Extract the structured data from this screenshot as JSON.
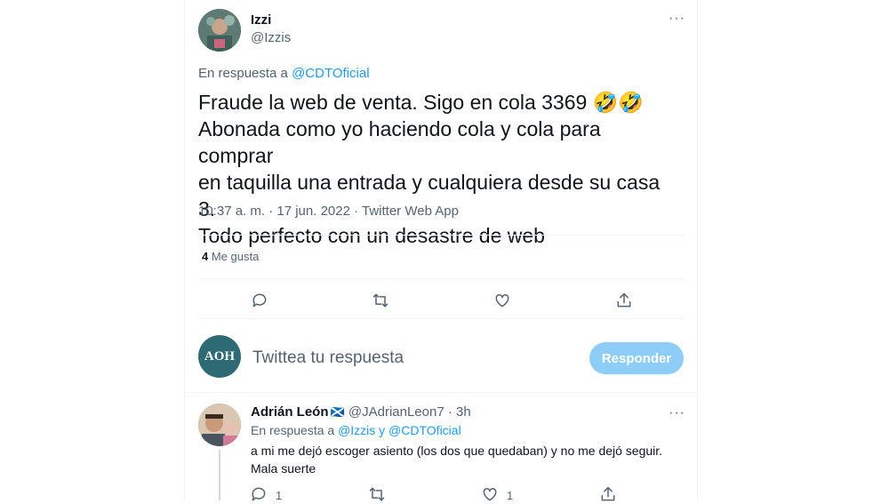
{
  "main_tweet": {
    "author_name": "Izzi",
    "author_handle": "@Izzis",
    "reply_prefix": "En respuesta a ",
    "reply_to": "@CDTOficial",
    "text_lines": [
      "Fraude la web de venta. Sigo en cola 3369 🤣🤣",
      "Abonada como yo haciendo cola y cola para comprar",
      "en taquilla una entrada y cualquiera desde su casa 3.",
      "Todo perfecto con un desastre de web"
    ],
    "meta": "10:37 a. m. · 17 jun. 2022 · Twitter Web App",
    "likes_count": "4",
    "likes_label": " Me gusta",
    "more": "···"
  },
  "composer": {
    "avatar_text": "AOH",
    "placeholder": "Twittea tu respuesta",
    "button_label": "Responder"
  },
  "reply": {
    "author_name": "Adrián León",
    "flag": "🏴󠁧󠁢󠁳󠁣󠁴󠁿",
    "author_handle": "@JAdrianLeon7",
    "time": " · 3h",
    "reply_prefix": "En respuesta a ",
    "reply_to": "@Izzis y @CDTOficial",
    "text_lines": [
      "a mi me dejó escoger asiento (los dos que quedaban) y no me dejó seguir.",
      "Mala suerte"
    ],
    "reply_count": "1",
    "like_count": "1",
    "more": "···"
  },
  "colors": {
    "accent": "#1d9bf0",
    "button_disabled": "#8ecdf8",
    "secondary_text": "#536471"
  }
}
